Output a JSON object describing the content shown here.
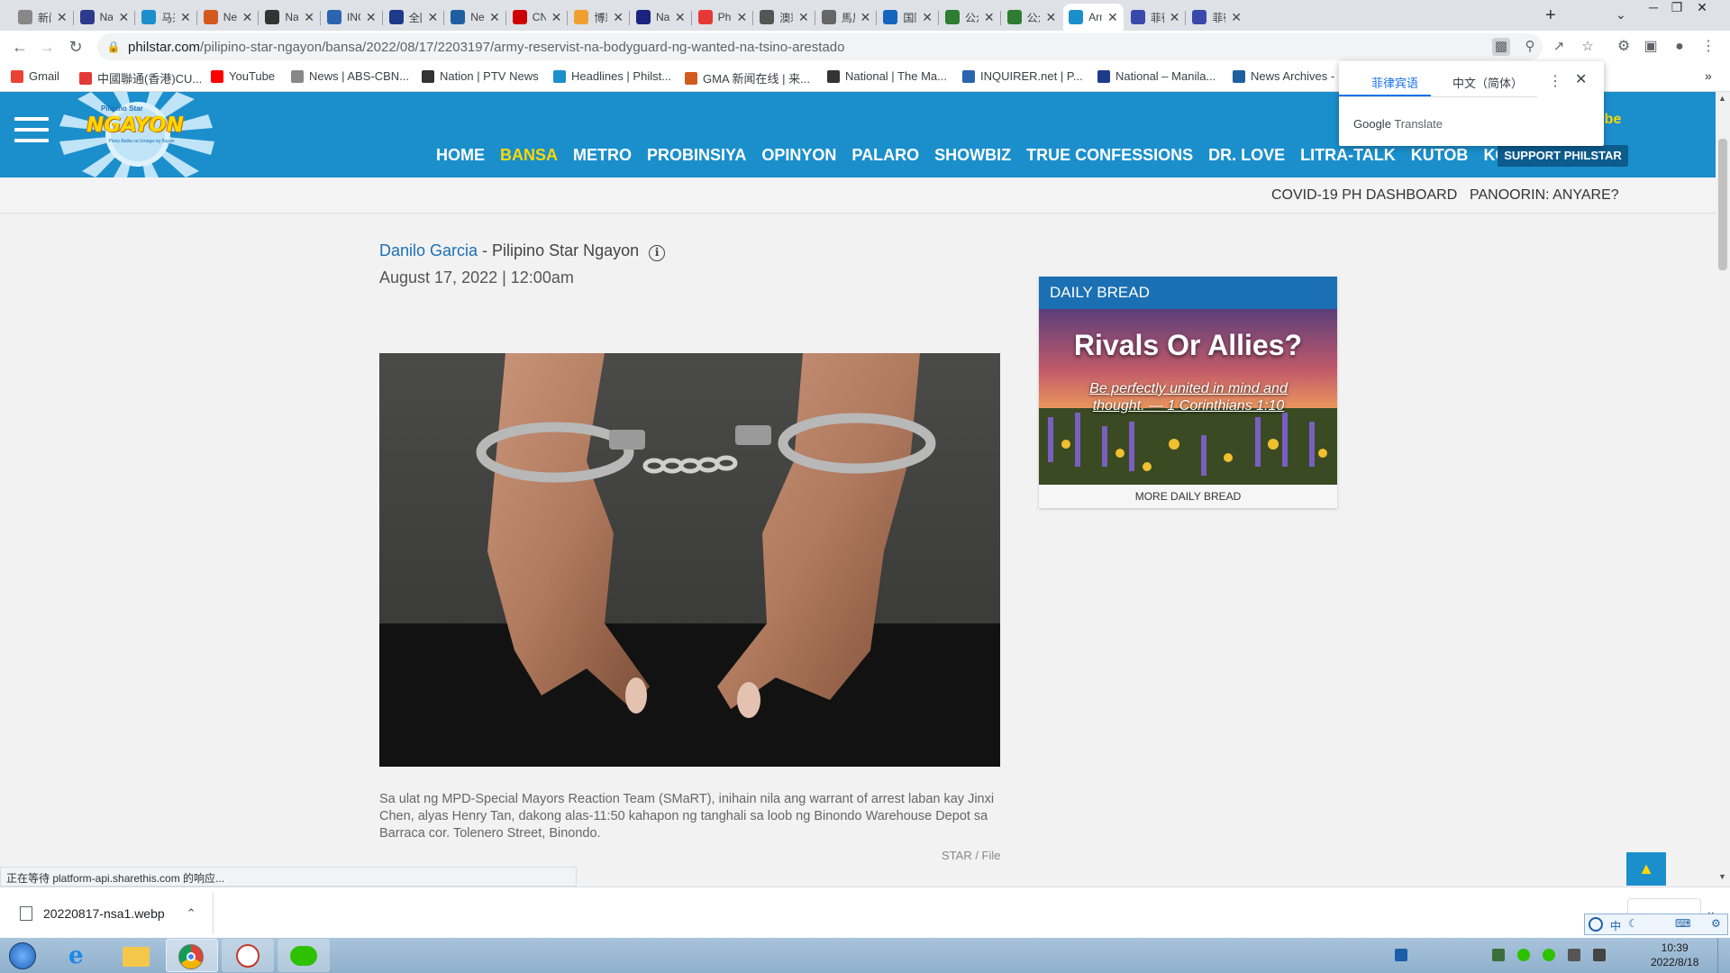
{
  "browser": {
    "tabs": [
      {
        "label": "新闻",
        "color": "#888888"
      },
      {
        "label": "Nat",
        "color": "#2b3a8c"
      },
      {
        "label": "马来",
        "color": "#1b8fcc"
      },
      {
        "label": "Nev",
        "color": "#d35a1f"
      },
      {
        "label": "Nat",
        "color": "#333333"
      },
      {
        "label": "INC",
        "color": "#2b65b0"
      },
      {
        "label": "全国",
        "color": "#1e3a8a"
      },
      {
        "label": "Nev",
        "color": "#1e5fa0"
      },
      {
        "label": "CNI",
        "color": "#cc0000"
      },
      {
        "label": "博彩",
        "color": "#f0a030"
      },
      {
        "label": "Nat",
        "color": "#1a237e"
      },
      {
        "label": "Phil",
        "color": "#e53935"
      },
      {
        "label": "澳彩",
        "color": "#555555"
      },
      {
        "label": "馬尼",
        "color": "#666666"
      },
      {
        "label": "国际",
        "color": "#1565c0"
      },
      {
        "label": "公众",
        "color": "#2e7d32"
      },
      {
        "label": "公众",
        "color": "#2e7d32"
      },
      {
        "label": "Arm",
        "color": "#1b8fcc"
      },
      {
        "label": "菲律",
        "color": "#3949ab"
      },
      {
        "label": "菲律",
        "color": "#3949ab"
      }
    ],
    "active_tab_index": 17,
    "url_host": "philstar.com",
    "url_path": "/pilipino-star-ngayon/bansa/2022/08/17/2203197/army-reservist-na-bodyguard-ng-wanted-na-tsino-arestado",
    "bookmarks": [
      {
        "label": "Gmail",
        "color": "#ea4335"
      },
      {
        "label": "中國聯通(香港)CU...",
        "color": "#e53935"
      },
      {
        "label": "YouTube",
        "color": "#ff0000"
      },
      {
        "label": "News | ABS-CBN...",
        "color": "#888888"
      },
      {
        "label": "Nation | PTV News",
        "color": "#333333"
      },
      {
        "label": "Headlines | Philst...",
        "color": "#1b8fcc"
      },
      {
        "label": "GMA 新闻在线 | 来...",
        "color": "#d35a1f"
      },
      {
        "label": "National | The Ma...",
        "color": "#333333"
      },
      {
        "label": "INQUIRER.net | P...",
        "color": "#2b65b0"
      },
      {
        "label": "National – Manila...",
        "color": "#1e3a8a"
      },
      {
        "label": "News Archives -",
        "color": "#1e5fa0"
      }
    ]
  },
  "translate_popup": {
    "source_lang": "菲律宾语",
    "target_lang": "中文（简体）",
    "brand_google": "Google",
    "brand_translate": "Translate"
  },
  "site": {
    "logo_top": "Pilipino Star",
    "logo_text": "NGAYON",
    "logo_tagline": "Pinoy Balita sa Umaga ng Bayan",
    "nav": [
      "HOME",
      "BANSA",
      "METRO",
      "PROBINSIYA",
      "OPINYON",
      "PALARO",
      "SHOWBIZ",
      "TRUE CONFESSIONS",
      "DR. LOVE",
      "LITRA-TALK",
      "KUTOB",
      "KOMIKS"
    ],
    "nav_active": "BANSA",
    "support_label": "SUPPORT PHILSTAR",
    "subscribe_peek": "ribe",
    "subnav": [
      "COVID-19 PH DASHBOARD",
      "PANOORIN: ANYARE?"
    ]
  },
  "article": {
    "author": "Danilo Garcia",
    "outlet": " - Pilipino Star Ngayon",
    "info_icon": "info-icon",
    "date": "August 17, 2022 | 12:00am",
    "caption": "Sa ulat ng MPD-Special Mayors Reaction Team (SMaRT), inihain nila ang warrant of arrest laban kay Jinxi Chen, alyas Henry Tan, dakong alas-11:50 kahapon ng tanghali sa loob ng Binondo Warehouse Depot sa Barraca cor. Tolenero Street, Binondo.",
    "credit": "STAR / File"
  },
  "daily_bread": {
    "header": "DAILY BREAD",
    "title": "Rivals Or Allies?",
    "verse": "Be perfectly united in mind and thought. — 1 Corinthians 1:10",
    "more": "MORE DAILY BREAD"
  },
  "status_text": "正在等待 platform-api.sharethis.com 的响应...",
  "download": {
    "filename": "20220817-nsa1.webp"
  },
  "taskbar": {
    "time": "10:39",
    "date": "2022/8/18",
    "ime_label": "中"
  }
}
